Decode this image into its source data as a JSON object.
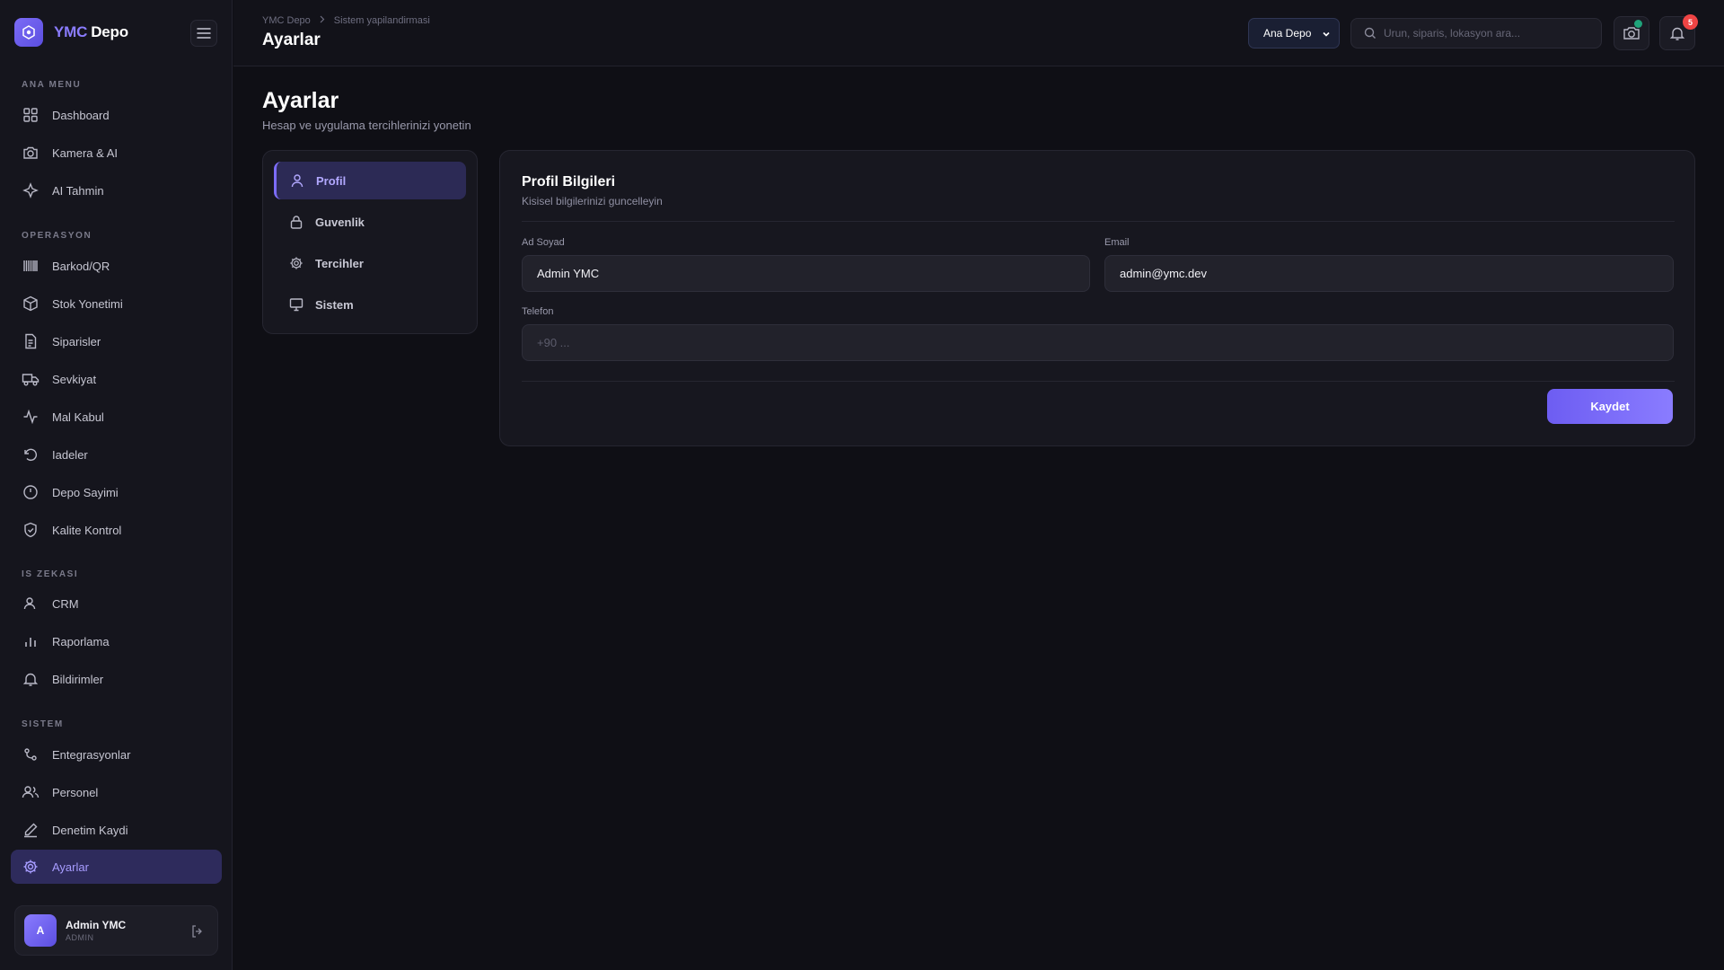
{
  "brand": {
    "part1": "YMC",
    "part2": "Depo"
  },
  "sidebar": {
    "sections": {
      "main": "ANA MENU",
      "ops": "OPERASYON",
      "bi": "IS ZEKASI",
      "system": "SISTEM"
    },
    "items": [
      {
        "label": "Dashboard",
        "icon": "grid-icon"
      },
      {
        "label": "Kamera & AI",
        "icon": "camera-icon"
      },
      {
        "label": "AI Tahmin",
        "icon": "ai-icon"
      },
      {
        "label": "Barkod/QR",
        "icon": "barcode-icon"
      },
      {
        "label": "Stok Yonetimi",
        "icon": "box-icon"
      },
      {
        "label": "Siparisler",
        "icon": "document-icon"
      },
      {
        "label": "Sevkiyat",
        "icon": "truck-icon"
      },
      {
        "label": "Mal Kabul",
        "icon": "activity-icon"
      },
      {
        "label": "Iadeler",
        "icon": "undo-icon"
      },
      {
        "label": "Depo Sayimi",
        "icon": "clock-icon"
      },
      {
        "label": "Kalite Kontrol",
        "icon": "shield-icon"
      },
      {
        "label": "CRM",
        "icon": "user-icon"
      },
      {
        "label": "Raporlama",
        "icon": "bar-chart-icon"
      },
      {
        "label": "Bildirimler",
        "icon": "bell-icon"
      },
      {
        "label": "Entegrasyonlar",
        "icon": "integration-icon"
      },
      {
        "label": "Personel",
        "icon": "users-icon"
      },
      {
        "label": "Denetim Kaydi",
        "icon": "pen-icon"
      },
      {
        "label": "Ayarlar",
        "icon": "gear-icon"
      }
    ],
    "active": "Ayarlar"
  },
  "user": {
    "initial": "A",
    "name": "Admin YMC",
    "role": "ADMIN"
  },
  "topbar": {
    "breadcrumb": [
      "YMC Depo",
      "Sistem yapilandirmasi"
    ],
    "title": "Ayarlar",
    "warehouse": "Ana Depo",
    "search_placeholder": "Urun, siparis, lokasyon ara...",
    "notification_count": "5"
  },
  "page": {
    "title": "Ayarlar",
    "subtitle": "Hesap ve uygulama tercihlerinizi yonetin"
  },
  "settings_nav": [
    {
      "label": "Profil",
      "icon": "user-icon",
      "active": true
    },
    {
      "label": "Guvenlik",
      "icon": "lock-icon",
      "active": false
    },
    {
      "label": "Tercihler",
      "icon": "gear-icon",
      "active": false
    },
    {
      "label": "Sistem",
      "icon": "monitor-icon",
      "active": false
    }
  ],
  "profile": {
    "title": "Profil Bilgileri",
    "subtitle": "Kisisel bilgilerinizi guncelleyin",
    "name_label": "Ad Soyad",
    "name_value": "Admin YMC",
    "email_label": "Email",
    "email_value": "admin@ymc.dev",
    "phone_label": "Telefon",
    "phone_value": "",
    "phone_placeholder": "+90 ...",
    "save_label": "Kaydet"
  },
  "colors": {
    "accent": "#7c6cf6",
    "background": "#0f0f15",
    "badge": "#ef4444",
    "online": "#1fa37a"
  }
}
